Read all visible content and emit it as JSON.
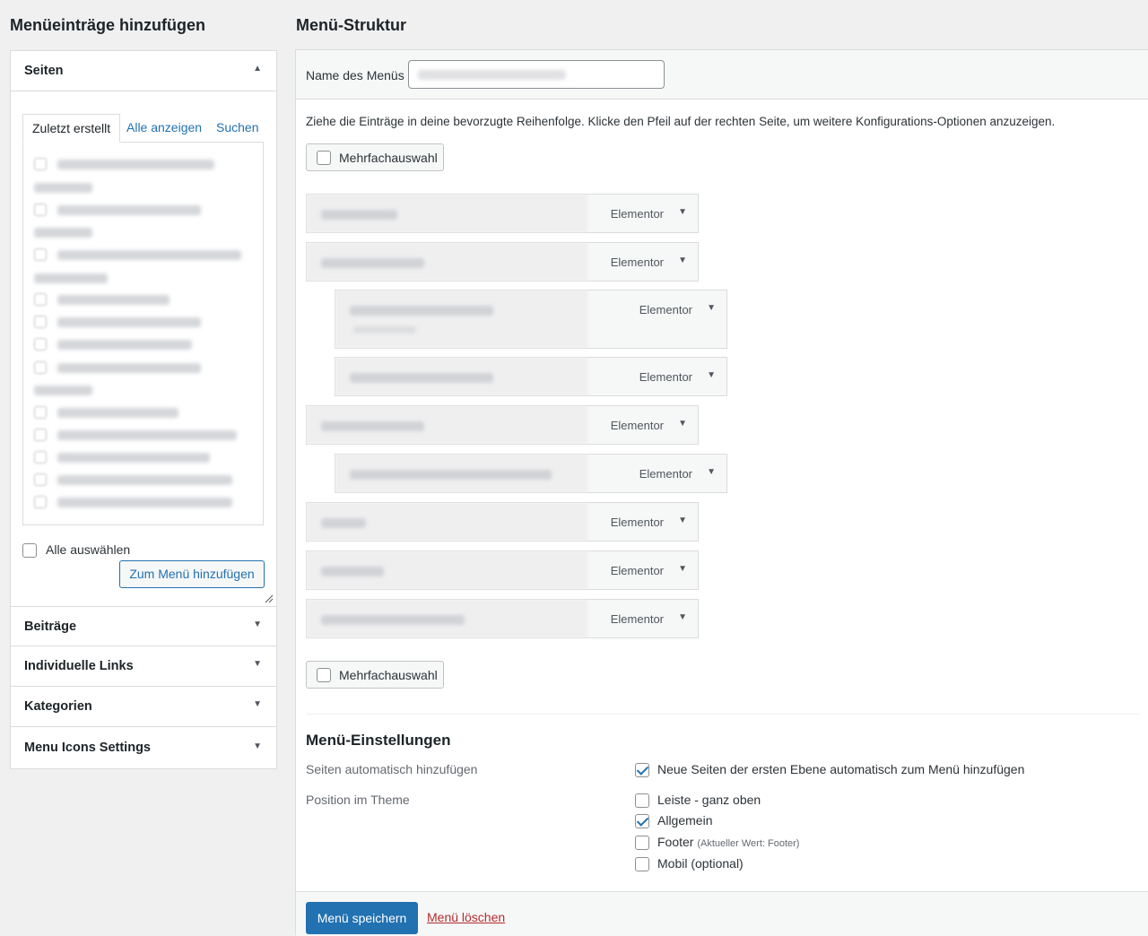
{
  "left": {
    "title": "Menüeinträge hinzufügen",
    "pages_section": {
      "label": "Seiten",
      "tabs": [
        "Zuletzt erstellt",
        "Alle anzeigen",
        "Suchen"
      ],
      "select_all_label": "Alle auswählen",
      "add_button_label": "Zum Menü hinzufügen"
    },
    "sections": [
      "Beiträge",
      "Individuelle Links",
      "Kategorien",
      "Menu Icons Settings"
    ]
  },
  "right": {
    "title": "Menü-Struktur",
    "name_label": "Name des Menüs",
    "instructions": "Ziehe die Einträge in deine bevorzugte Reihenfolge. Klicke den Pfeil auf der rechten Seite, um weitere Konfigurations-Optionen anzuzeigen.",
    "bulk_select_label": "Mehrfachauswahl",
    "menu_items": [
      {
        "type": "Elementor",
        "level": 0
      },
      {
        "type": "Elementor",
        "level": 0
      },
      {
        "type": "Elementor",
        "level": 1
      },
      {
        "type": "Elementor",
        "level": 1
      },
      {
        "type": "Elementor",
        "level": 0
      },
      {
        "type": "Elementor",
        "level": 1
      },
      {
        "type": "Elementor",
        "level": 0
      },
      {
        "type": "Elementor",
        "level": 0
      },
      {
        "type": "Elementor",
        "level": 0
      }
    ],
    "settings": {
      "title": "Menü-Einstellungen",
      "auto_add_label": "Seiten automatisch hinzufügen",
      "auto_add_option": "Neue Seiten der ersten Ebene automatisch zum Menü hinzufügen",
      "position_label": "Position im Theme",
      "positions": [
        {
          "label": "Leiste - ganz oben",
          "note": "",
          "checked": false
        },
        {
          "label": "Allgemein",
          "note": "",
          "checked": true
        },
        {
          "label": "Footer",
          "note": "(Aktueller Wert: Footer)",
          "checked": false
        },
        {
          "label": "Mobil (optional)",
          "note": "",
          "checked": false
        }
      ]
    },
    "save_button_label": "Menü speichern",
    "delete_link_label": "Menü löschen"
  },
  "colors": {
    "primary": "#2271b1",
    "danger": "#b32d2e",
    "background": "#f0f0f1"
  }
}
